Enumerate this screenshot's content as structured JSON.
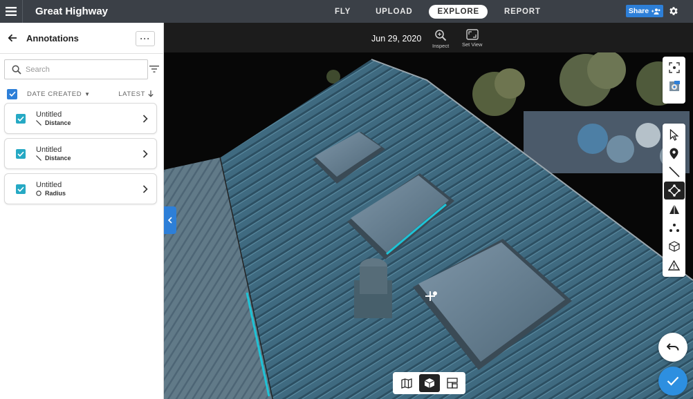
{
  "app": {
    "project_title": "Great Highway",
    "nav_tabs": [
      {
        "label": "FLY",
        "active": false
      },
      {
        "label": "UPLOAD",
        "active": false
      },
      {
        "label": "EXPLORE",
        "active": true
      },
      {
        "label": "REPORT",
        "active": false
      }
    ],
    "share_label": "Share",
    "accent_color": "#2d7fd8"
  },
  "sidebar": {
    "title": "Annotations",
    "more_label": "···",
    "search_placeholder": "Search",
    "sort_field": "DATE CREATED",
    "sort_order": "LATEST",
    "annotations": [
      {
        "name": "Untitled",
        "type": "Distance",
        "type_icon": "line-icon",
        "checked": true
      },
      {
        "name": "Untitled",
        "type": "Distance",
        "type_icon": "line-icon",
        "checked": true
      },
      {
        "name": "Untitled",
        "type": "Radius",
        "type_icon": "circle-icon",
        "checked": true
      }
    ]
  },
  "viewport": {
    "date": "Jun 29, 2020",
    "header_tools": [
      {
        "label": "Inspect",
        "icon": "zoom-icon"
      },
      {
        "label": "Set View",
        "icon": "frame-icon"
      }
    ],
    "side_tools": [
      "fit-view-icon",
      "view-settings-icon"
    ],
    "annotation_tools": [
      {
        "icon": "cursor-icon",
        "active": false
      },
      {
        "icon": "location-pin-icon",
        "active": false
      },
      {
        "icon": "distance-line-icon",
        "active": false
      },
      {
        "icon": "polygon-icon",
        "active": true
      },
      {
        "icon": "height-icon",
        "active": false
      },
      {
        "icon": "points-icon",
        "active": false
      },
      {
        "icon": "volume-cube-icon",
        "active": false
      },
      {
        "icon": "warning-icon",
        "active": false
      }
    ],
    "view_modes": [
      {
        "icon": "map-icon",
        "active": false
      },
      {
        "icon": "3d-model-icon",
        "active": true
      },
      {
        "icon": "layout-icon",
        "active": false
      }
    ],
    "measurement_color": "#1fc3d6"
  }
}
